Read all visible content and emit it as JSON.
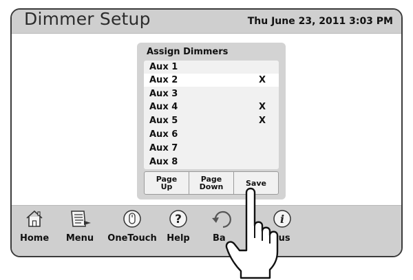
{
  "header": {
    "title": "Dimmer Setup",
    "datetime": "Thu June 23, 2011  3:03 PM"
  },
  "dialog": {
    "title": "Assign Dimmers",
    "rows": [
      {
        "label": "Aux 1",
        "mark": ""
      },
      {
        "label": "Aux 2",
        "mark": "X",
        "selected": true
      },
      {
        "label": "Aux 3",
        "mark": ""
      },
      {
        "label": "Aux 4",
        "mark": "X"
      },
      {
        "label": "Aux 5",
        "mark": "X"
      },
      {
        "label": "Aux 6",
        "mark": ""
      },
      {
        "label": "Aux 7",
        "mark": ""
      },
      {
        "label": "Aux 8",
        "mark": ""
      }
    ],
    "buttons": {
      "page_up": "Page\nUp",
      "page_down": "Page\nDown",
      "save": "Save"
    }
  },
  "nav": {
    "home": "Home",
    "menu": "Menu",
    "onetouch": "OneTouch",
    "help": "Help",
    "back": "Ba",
    "status": "tus"
  },
  "icons": {
    "home": "home-icon",
    "menu": "menu-icon",
    "onetouch": "onetouch-icon",
    "help": "help-icon",
    "back": "back-icon",
    "status": "info-icon",
    "pointer": "pointing-hand-icon"
  }
}
